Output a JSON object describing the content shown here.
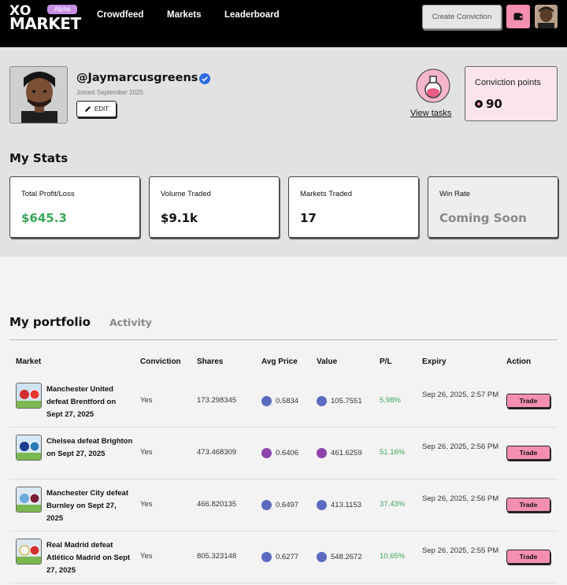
{
  "header": {
    "logo_top": "XO",
    "logo_bottom": "MARKET",
    "badge": "Alpha",
    "nav": [
      "Crowdfeed",
      "Markets",
      "Leaderboard"
    ],
    "create_label": "Create Conviction",
    "icons": {
      "wallet": "wallet-icon",
      "avatar": "user-avatar"
    }
  },
  "profile": {
    "username": "@Jaymarcusgreens",
    "joined": "Joined September 2025",
    "edit_label": "EDIT",
    "view_tasks": "View tasks",
    "points_label": "Conviction points",
    "points_value": "90"
  },
  "stats": {
    "title": "My Stats",
    "cards": [
      {
        "label": "Total Profit/Loss",
        "value": "$645.3",
        "color": "#3aa65a"
      },
      {
        "label": "Volume Traded",
        "value": "$9.1k",
        "color": "#111111"
      },
      {
        "label": "Markets Traded",
        "value": "17",
        "color": "#111111"
      },
      {
        "label": "Win Rate",
        "value": "Coming Soon",
        "color": "#888888"
      }
    ]
  },
  "portfolio": {
    "tab_active": "My portfolio",
    "tab_other": "Activity",
    "columns": [
      "Market",
      "Conviction",
      "Shares",
      "Avg Price",
      "Value",
      "P/L",
      "Expiry",
      "Action"
    ],
    "rows": [
      {
        "market": "Manchester United defeat Brentford on Sept 27, 2025",
        "conviction": "Yes",
        "shares": "173.298345",
        "avg_price": "0.5834",
        "value": "105.7551",
        "pl": "5.98%",
        "expiry": "Sep 26, 2025, 2:57 PM",
        "action": "Trade",
        "coin_color": "#5c6bc0"
      },
      {
        "market": "Chelsea defeat Brighton on Sept 27, 2025",
        "conviction": "Yes",
        "shares": "473.468309",
        "avg_price": "0.6406",
        "value": "461.6259",
        "pl": "51.16%",
        "expiry": "Sep 26, 2025, 2:56 PM",
        "action": "Trade",
        "coin_color": "#8e44ad"
      },
      {
        "market": "Manchester City defeat Burnley on Sept 27, 2025",
        "conviction": "Yes",
        "shares": "466.820135",
        "avg_price": "0.6497",
        "value": "413.1153",
        "pl": "37.43%",
        "expiry": "Sep 26, 2025, 2:56 PM",
        "action": "Trade",
        "coin_color": "#5c6bc0"
      },
      {
        "market": "Real Madrid defeat Atlético Madrid on Sept 27, 2025",
        "conviction": "Yes",
        "shares": "805.323148",
        "avg_price": "0.6277",
        "value": "548.2672",
        "pl": "10.65%",
        "expiry": "Sep 26, 2025, 2:55 PM",
        "action": "Trade",
        "coin_color": "#5c6bc0"
      }
    ]
  }
}
